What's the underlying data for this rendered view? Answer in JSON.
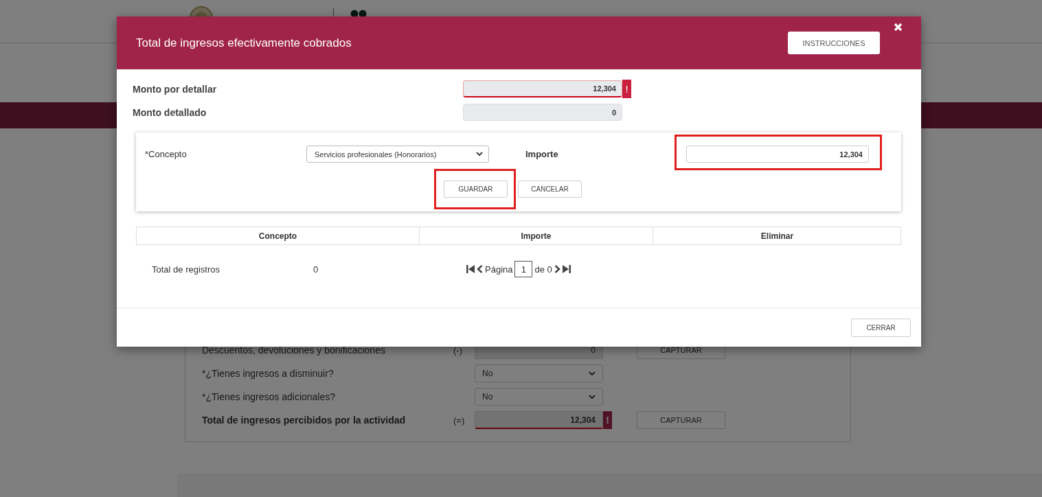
{
  "background_form": {
    "rows": [
      {
        "kind": "amount",
        "label": "Descuentos, devoluciones y bonificaciones",
        "bold": false,
        "operator": "(-)",
        "value": "0",
        "button": "CAPTURAR"
      },
      {
        "kind": "select",
        "label": "*¿Tienes ingresos a disminuir?",
        "bold": false,
        "value": "No"
      },
      {
        "kind": "select",
        "label": "*¿Tienes ingresos adicionales?",
        "bold": false,
        "value": "No"
      },
      {
        "kind": "amount",
        "label": "Total de ingresos percibidos por la actividad",
        "bold": true,
        "operator": "(=)",
        "value": "12,304",
        "alert": "!",
        "button": "CAPTURAR"
      }
    ]
  },
  "modal": {
    "title": "Total de ingresos efectivamente cobrados",
    "instructions_button": "INSTRUCCIONES",
    "summary": [
      {
        "label": "Monto por detallar",
        "value": "12,304",
        "alert": "!"
      },
      {
        "label": "Monto detallado",
        "value": "0"
      }
    ],
    "form": {
      "concept_label": "*Concepto",
      "concept_value": "Servicios profesionales (Honorarios)",
      "amount_label": "Importe",
      "amount_value": "12,304",
      "amount_highlighted": true,
      "buttons": [
        {
          "label": "GUARDAR",
          "highlighted": true
        },
        {
          "label": "CANCELAR",
          "highlighted": false
        }
      ]
    },
    "table": {
      "columns": [
        "Concepto",
        "Importe",
        "Eliminar"
      ]
    },
    "totals": {
      "label": "Total de registros",
      "count": "0"
    },
    "pager": {
      "page_label": "Página",
      "page": "1",
      "of_label": "de 0"
    },
    "footer_button": "CERRAR"
  }
}
